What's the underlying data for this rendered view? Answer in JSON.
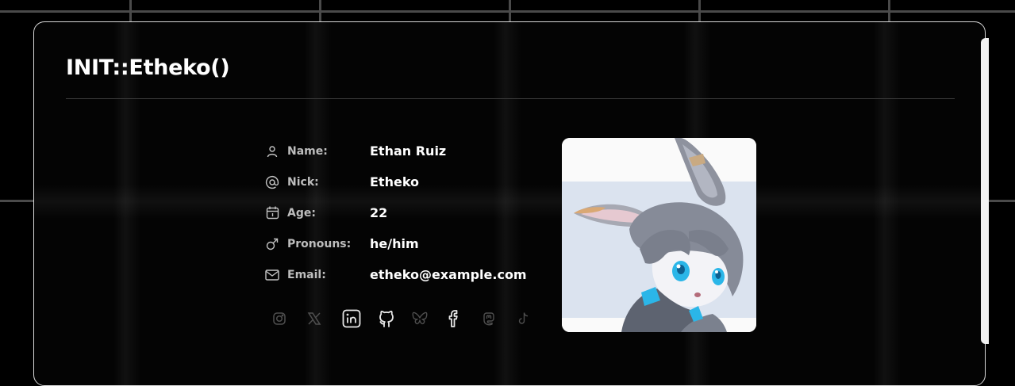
{
  "profile": {
    "title": "INIT::Etheko()",
    "fields": [
      {
        "icon": "user-icon",
        "label": "Name:",
        "value": "Ethan Ruiz"
      },
      {
        "icon": "at-icon",
        "label": "Nick:",
        "value": "Etheko"
      },
      {
        "icon": "calendar-icon",
        "label": "Age:",
        "value": "22"
      },
      {
        "icon": "male-icon",
        "label": "Pronouns:",
        "value": "he/him"
      },
      {
        "icon": "mail-icon",
        "label": "Email:",
        "value": "etheko@example.com"
      }
    ],
    "socials": [
      {
        "icon": "instagram-icon",
        "active": false
      },
      {
        "icon": "x-icon",
        "active": false
      },
      {
        "icon": "linkedin-icon",
        "active": true
      },
      {
        "icon": "github-icon",
        "active": true
      },
      {
        "icon": "bluesky-icon",
        "active": false
      },
      {
        "icon": "facebook-icon",
        "active": true
      },
      {
        "icon": "mastodon-icon",
        "active": false
      },
      {
        "icon": "tiktok-icon",
        "active": false
      }
    ],
    "avatar": "anime-bunny-avatar"
  },
  "colors": {
    "background": "#000000",
    "grid_line": "#4a4a4a",
    "card_border": "#d8d8d8",
    "label": "#bdbdbd",
    "value": "#ffffff",
    "icon_dim": "#4f4f4f",
    "avatar_band": "#dbe3ef",
    "accent_blue": "#2bb6e8"
  }
}
